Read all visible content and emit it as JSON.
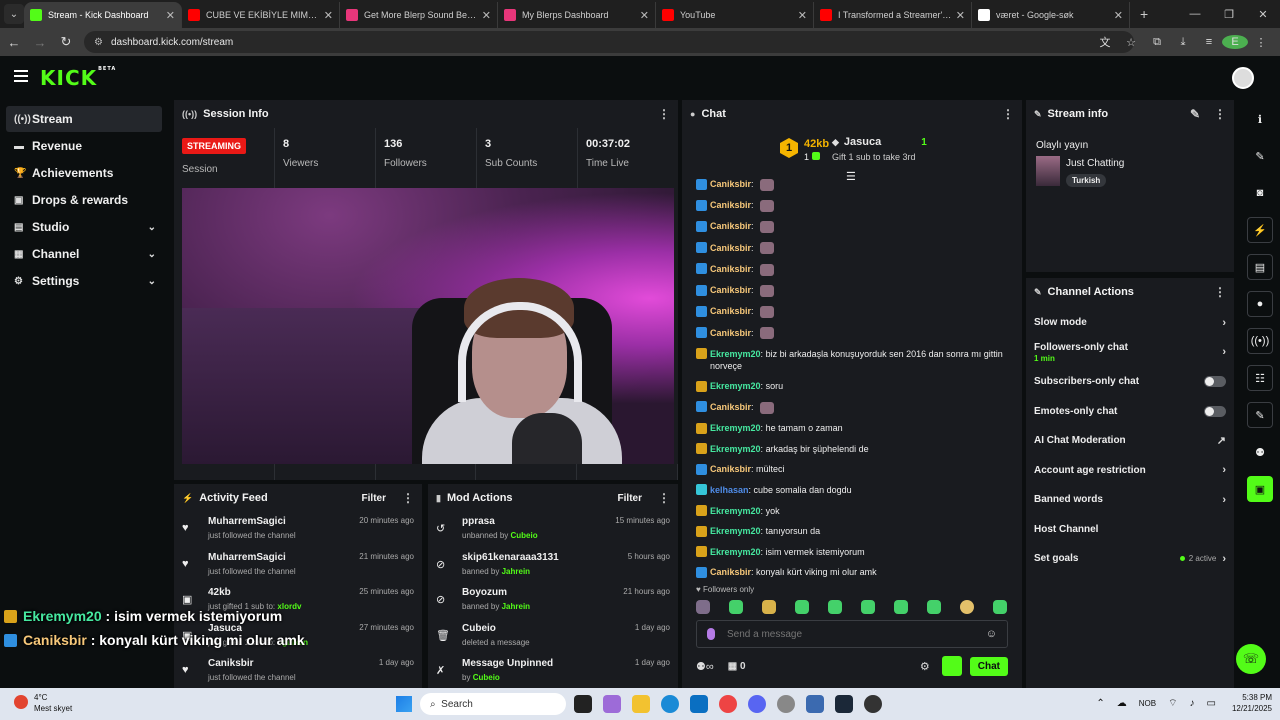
{
  "browser": {
    "tabs": [
      {
        "title": "Stream - Kick Dashboard",
        "active": true,
        "favicon_color": "#53fc18"
      },
      {
        "title": "CUBE VE EKİBİYLE MIMESIS'TE",
        "active": false,
        "favicon_color": "#ff0000"
      },
      {
        "title": "Get More Blerp Sound Beets!",
        "active": false,
        "favicon_color": "#e8367a"
      },
      {
        "title": "My Blerps Dashboard",
        "active": false,
        "favicon_color": "#e8367a"
      },
      {
        "title": "YouTube",
        "active": false,
        "favicon_color": "#ff0000"
      },
      {
        "title": "I Transformed a Streamer's Life",
        "active": false,
        "favicon_color": "#ff0000"
      },
      {
        "title": "været - Google-søk",
        "active": false,
        "favicon_color": "#ffffff"
      }
    ],
    "url": "dashboard.kick.com/stream",
    "profile_initial": "E"
  },
  "header": {
    "logo": "KICK",
    "logo_sup": "BETA"
  },
  "sidebar": {
    "items": [
      {
        "label": "Stream",
        "icon": "broadcast-icon",
        "glyph": "((•))",
        "active": true,
        "expandable": false
      },
      {
        "label": "Revenue",
        "icon": "revenue-icon",
        "glyph": "▬",
        "active": false,
        "expandable": false
      },
      {
        "label": "Achievements",
        "icon": "trophy-icon",
        "glyph": "🏆",
        "active": false,
        "expandable": false
      },
      {
        "label": "Drops & rewards",
        "icon": "gift-icon",
        "glyph": "▣",
        "active": false,
        "expandable": false
      },
      {
        "label": "Studio",
        "icon": "studio-icon",
        "glyph": "▤",
        "active": false,
        "expandable": true
      },
      {
        "label": "Channel",
        "icon": "channel-icon",
        "glyph": "▦",
        "active": false,
        "expandable": true
      },
      {
        "label": "Settings",
        "icon": "gear-icon",
        "glyph": "⚙",
        "active": false,
        "expandable": true
      }
    ]
  },
  "session": {
    "title": "Session Info",
    "status_badge": "STREAMING",
    "status_label": "Session",
    "stats": [
      {
        "value": "8",
        "label": "Viewers"
      },
      {
        "value": "136",
        "label": "Followers"
      },
      {
        "value": "3",
        "label": "Sub Counts"
      },
      {
        "value": "00:37:02",
        "label": "Time Live"
      }
    ]
  },
  "activity": {
    "title": "Activity Feed",
    "filter_label": "Filter",
    "items": [
      {
        "name": "MuharremSagici",
        "sub": "just followed the channel",
        "sub_user": "",
        "time": "20 minutes ago",
        "icon": "heart-icon",
        "glyph": "♥"
      },
      {
        "name": "MuharremSagici",
        "sub": "just followed the channel",
        "sub_user": "",
        "time": "21 minutes ago",
        "icon": "heart-icon",
        "glyph": "♥"
      },
      {
        "name": "42kb",
        "sub": "just gifted 1 sub to:",
        "sub_user": "xlordv",
        "time": "25 minutes ago",
        "icon": "gift-icon",
        "glyph": "▣"
      },
      {
        "name": "Jasuca",
        "sub": "just gifted 1 sub to:",
        "sub_user": "ogulkan",
        "time": "27 minutes ago",
        "icon": "gift-icon",
        "glyph": "▣"
      },
      {
        "name": "Caniksbir",
        "sub": "just followed the channel",
        "sub_user": "",
        "time": "1 day ago",
        "icon": "heart-icon",
        "glyph": "♥"
      }
    ]
  },
  "mod": {
    "title": "Mod Actions",
    "filter_label": "Filter",
    "items": [
      {
        "name": "pprasa",
        "sub": "unbanned by",
        "sub_user": "Cubeio",
        "time": "15 minutes ago",
        "icon": "undo-icon",
        "glyph": "↺"
      },
      {
        "name": "skip61kenaraaa3131",
        "sub": "banned by",
        "sub_user": "Jahrein",
        "time": "5 hours ago",
        "icon": "ban-icon",
        "glyph": "⊘"
      },
      {
        "name": "Boyozum",
        "sub": "banned by",
        "sub_user": "Jahrein",
        "time": "21 hours ago",
        "icon": "ban-icon",
        "glyph": "⊘"
      },
      {
        "name": "Cubeio",
        "sub": "deleted a message",
        "sub_user": "",
        "time": "1 day ago",
        "icon": "trash-icon",
        "glyph": "🗑"
      },
      {
        "name": "Message Unpinned",
        "sub": "by",
        "sub_user": "Cubeio",
        "time": "1 day ago",
        "icon": "unpin-icon",
        "glyph": "✗"
      }
    ]
  },
  "chat": {
    "title": "Chat",
    "leaderboard": {
      "rank": "1",
      "top_name": "42kb",
      "top_count": "1",
      "second_name": "Jasuca",
      "second_count": "1",
      "gift_hint": "Gift 1 sub to take 3rd"
    },
    "messages": [
      {
        "user": "Caniksbir",
        "text": "",
        "emote": true,
        "badge": "blue",
        "color": "orange"
      },
      {
        "user": "Caniksbir",
        "text": "",
        "emote": true,
        "badge": "blue",
        "color": "orange"
      },
      {
        "user": "Caniksbir",
        "text": "",
        "emote": true,
        "badge": "blue",
        "color": "orange"
      },
      {
        "user": "Caniksbir",
        "text": "",
        "emote": true,
        "badge": "blue",
        "color": "orange"
      },
      {
        "user": "Caniksbir",
        "text": "",
        "emote": true,
        "badge": "blue",
        "color": "orange"
      },
      {
        "user": "Caniksbir",
        "text": "",
        "emote": true,
        "badge": "blue",
        "color": "orange"
      },
      {
        "user": "Caniksbir",
        "text": "",
        "emote": true,
        "badge": "blue",
        "color": "orange"
      },
      {
        "user": "Caniksbir",
        "text": "",
        "emote": true,
        "badge": "blue",
        "color": "orange"
      },
      {
        "user": "Ekremym20",
        "text": "biz bi arkadaşla konuşuyorduk sen 2016 dan sonra mı gittin norveçe",
        "emote": false,
        "badge": "gold",
        "color": "green"
      },
      {
        "user": "Ekremym20",
        "text": "soru",
        "emote": false,
        "badge": "gold",
        "color": "green"
      },
      {
        "user": "Caniksbir",
        "text": "",
        "emote": true,
        "badge": "blue",
        "color": "orange"
      },
      {
        "user": "Ekremym20",
        "text": "he tamam o zaman",
        "emote": false,
        "badge": "gold",
        "color": "green"
      },
      {
        "user": "Ekremym20",
        "text": "arkadaş bir şüphelendi de",
        "emote": false,
        "badge": "gold",
        "color": "green"
      },
      {
        "user": "Caniksbir",
        "text": "mülteci",
        "emote": false,
        "badge": "blue",
        "color": "orange"
      },
      {
        "user": "kelhasan",
        "text": "cube somalia dan dogdu",
        "emote": false,
        "badge": "teal",
        "color": "blue"
      },
      {
        "user": "Ekremym20",
        "text": "yok",
        "emote": false,
        "badge": "gold",
        "color": "green"
      },
      {
        "user": "Ekremym20",
        "text": "tanıyorsun da",
        "emote": false,
        "badge": "gold",
        "color": "green"
      },
      {
        "user": "Ekremym20",
        "text": "isim vermek istemiyorum",
        "emote": false,
        "badge": "gold",
        "color": "green"
      },
      {
        "user": "Caniksbir",
        "text": "konyalı kürt viking mi olur amk",
        "emote": false,
        "badge": "blue",
        "color": "orange"
      }
    ],
    "followers_only": "Followers only",
    "input_placeholder": "Send a message",
    "viewer_count_small": "0",
    "chat_button": "Chat"
  },
  "stream_info": {
    "title": "Stream info",
    "stream_title": "Olaylı yayın",
    "category": "Just Chatting",
    "tag": "Turkish"
  },
  "channel_actions": {
    "title": "Channel Actions",
    "items": [
      {
        "label": "Slow mode",
        "sub": "",
        "control": "chevron"
      },
      {
        "label": "Followers-only chat",
        "sub": "1 min",
        "control": "chevron"
      },
      {
        "label": "Subscribers-only chat",
        "sub": "",
        "control": "toggle"
      },
      {
        "label": "Emotes-only chat",
        "sub": "",
        "control": "toggle"
      },
      {
        "label": "AI Chat Moderation",
        "sub": "",
        "control": "external"
      },
      {
        "label": "Account age restriction",
        "sub": "",
        "control": "chevron"
      },
      {
        "label": "Banned words",
        "sub": "",
        "control": "chevron"
      },
      {
        "label": "Host Channel",
        "sub": "",
        "control": "none"
      },
      {
        "label": "Set goals",
        "sub": "",
        "control": "goals",
        "status": "2 active"
      }
    ]
  },
  "overlay": [
    {
      "user": "Ekremym20",
      "text": "isim vermek istemiyorum",
      "badge": "gold"
    },
    {
      "user": "Caniksbir",
      "text": "konyalı kürt viking mi olur amk",
      "badge": "blue"
    }
  ],
  "taskbar": {
    "weather_temp": "4°C",
    "weather_desc": "Mest skyet",
    "search_placeholder": "Search",
    "lang": "NOB",
    "time": "5:38 PM",
    "date": "12/21/2025"
  }
}
